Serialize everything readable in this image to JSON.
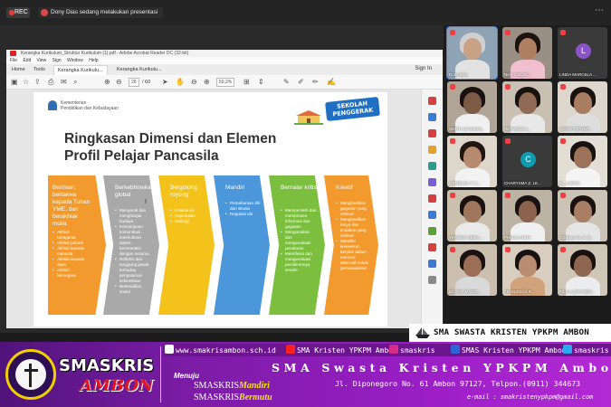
{
  "recording": {
    "label": "REC"
  },
  "presenter": {
    "text": "Dony Dias sedang melakukan presentasi"
  },
  "acrobat": {
    "window_title": "Kerangka Kurikulum_Struktur Kurikulum (1).pdf - Adobe Acrobat Reader DC (32-bit)",
    "menu": [
      "File",
      "Edit",
      "View",
      "Sign",
      "Window",
      "Help"
    ],
    "tabs": [
      "Home",
      "Tools",
      "Kerangka Kurikulu...",
      "Kerangka Kurikulu..."
    ],
    "sign_in": "Sign In",
    "page_current": "28",
    "page_total": "/ 60",
    "zoom": "59,2%"
  },
  "slide": {
    "ministry_line1": "Kementerian",
    "ministry_line2": "Pendidikan dan Kebudayaan",
    "badge": "SEKOLAH PENGGERAK",
    "title_line1": "Ringkasan Dimensi dan Elemen",
    "title_line2": "Profil Pelajar Pancasila",
    "dimensions": [
      {
        "heading": "Beriman, bertakwa kepada Tuhan YME, dan berakhlak mulia",
        "items": [
          "Akhlak beragama",
          "Akhlak pribadi",
          "Akhlak kepada manusia",
          "Akhlak kepada alam",
          "Akhlak bernegara"
        ],
        "color": "#f29a2e"
      },
      {
        "heading": "Berkebhinekaan global",
        "items": [
          "Mengenal dan menghargai budaya",
          "Kemampuan komunikasi interkultural dalam berinteraksi dengan sesama",
          "Refleksi dan tanggung jawab terhadap pengalaman kebinekaan",
          "Berkeadilan sosial"
        ],
        "color": "#a9a9a9"
      },
      {
        "heading": "Bergotong royong",
        "items": [
          "Kolaborasi",
          "Kepedulian",
          "Berbagi"
        ],
        "color": "#f3c21b"
      },
      {
        "heading": "Mandiri",
        "items": [
          "Pemahaman diri dan situasi",
          "Regulasi diri"
        ],
        "color": "#4c96da"
      },
      {
        "heading": "Bernalar kritis",
        "items": [
          "Memperoleh dan memproses informasi dan gagasan",
          "Menganalisis dan mengevaluasi penalaran",
          "Merefleksi dan mengevaluasi pemikirannya sendiri"
        ],
        "color": "#7cbf3f"
      },
      {
        "heading": "Kreatif",
        "items": [
          "Menghasilkan gagasan yang orisinal",
          "Menghasilkan karya dan tindakan yang orisinal",
          "Memiliki keluwesan berpikir dalam mencari alternatif solusi permasalahan"
        ],
        "color": "#f29a2e"
      }
    ]
  },
  "participants": [
    {
      "name": "Dony Dias",
      "kind": "video",
      "skin": "#c9a184",
      "hair": "#cfcfcf",
      "body": "#e2e2e2",
      "bg": "#8ea3b6"
    },
    {
      "name": "Nelly Gasperz",
      "kind": "video",
      "skin": "#b07f63",
      "hair": "#1c120e",
      "body": "#f1c0cf",
      "bg": "#9a8f85"
    },
    {
      "name": "LINDA MARCELA ...",
      "kind": "avatar",
      "initial": "L",
      "color": "#8a54c9",
      "bg": "#3a3a3a"
    },
    {
      "name": "SMITH LEASIWAL",
      "kind": "video",
      "skin": "#7d5a45",
      "hair": "#1a1210",
      "body": "#f0f0f0",
      "bg": "#b1a597"
    },
    {
      "name": "REYWOLD L...",
      "kind": "video",
      "skin": "#8f6a54",
      "hair": "#1a1210",
      "body": "#e8e8e8",
      "bg": "#c9c0b3"
    },
    {
      "name": "CHRISTOPHER...",
      "kind": "video",
      "skin": "#a97d61",
      "hair": "#1a1210",
      "body": "#dedede",
      "bg": "#dcd6cc"
    },
    {
      "name": "GRIZELDA T. S...",
      "kind": "video",
      "skin": "#b68a6f",
      "hair": "#20150f",
      "body": "#f2f2f2",
      "bg": "#ddd6cb"
    },
    {
      "name": "CHARYSMA Z. LE...",
      "kind": "avatar",
      "initial": "C",
      "color": "#0f9bb0",
      "bg": "#3a3a3a"
    },
    {
      "name": "E...A MAYA",
      "kind": "video",
      "skin": "#9c725a",
      "hair": "#1a1210",
      "body": "#f4f4f4",
      "bg": "#e2ddd5"
    },
    {
      "name": "VIRGINIA SEMA...",
      "kind": "video",
      "skin": "#a0765c",
      "hair": "#1a1210",
      "body": "#e9e9e9",
      "bg": "#cbbfae"
    },
    {
      "name": "PHELIA ANITA",
      "kind": "video",
      "skin": "#8b634d",
      "hair": "#1a1210",
      "body": "#f0f0f0",
      "bg": "#bdb3a5"
    },
    {
      "name": "GISELLA G. S. E...",
      "kind": "video",
      "skin": "#a87e64",
      "hair": "#1a1210",
      "body": "#e5e5e5",
      "bg": "#ccc3b7"
    },
    {
      "name": "ELGINA MARIS...",
      "kind": "video",
      "skin": "#9a6f56",
      "hair": "#1a1210",
      "body": "#d9d9d9",
      "bg": "#cbbfb0"
    },
    {
      "name": "FRANSISCA R...",
      "kind": "video",
      "skin": "#b88d71",
      "hair": "#1a1210",
      "body": "#d0a37a",
      "bg": "#d8cdbf"
    },
    {
      "name": "FILIA ALEXANDR...",
      "kind": "video",
      "skin": "#8f6650",
      "hair": "#1a1210",
      "body": "#ececec",
      "bg": "#cfc6b8"
    }
  ],
  "ticker": {
    "text": "SMA SWASTA KRISTEN YPKPM AMBON"
  },
  "footer": {
    "brand_line1": "SMASKRIS",
    "brand_line2": "AMBON",
    "socials": [
      {
        "icon": "globe-icon",
        "text": "www.smakrisambon.sch.id",
        "color": "#ffffff"
      },
      {
        "icon": "youtube-icon",
        "text": "SMA Kristen YPKPM Ambon",
        "color": "#ff1f1f"
      },
      {
        "icon": "instagram-icon",
        "text": "smaskris",
        "color": "#d62b8a"
      },
      {
        "icon": "facebook-icon",
        "text": "SMAS Kristen YPKPM Ambon",
        "color": "#2c63d6"
      },
      {
        "icon": "twitter-icon",
        "text": "smaskris",
        "color": "#2aa9f0"
      }
    ],
    "menuju": "Menuju",
    "motto1_prefix": "SMASKRIS",
    "motto1_word": "Mandiri",
    "motto2_prefix": "SMASKRIS",
    "motto2_word": "Bermutu",
    "school_name": "SMA Swasta Kristen YPKPM Ambon",
    "address": "Jl. Diponegoro  No. 61 Ambon 97127, Telpon.(0911) 344673",
    "email": "e-mail : smakristenypkpm@gmail.com"
  }
}
